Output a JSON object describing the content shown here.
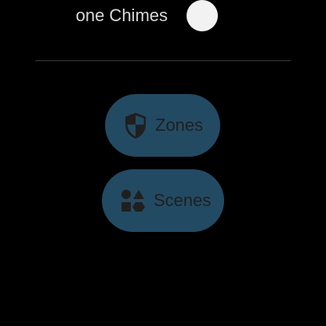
{
  "header": {
    "title_partial": "one Chimes"
  },
  "buttons": [
    {
      "label": "Zones",
      "icon": "shield-icon"
    },
    {
      "label": "Scenes",
      "icon": "shapes-icon"
    }
  ],
  "colors": {
    "pill_bg": "#234a63",
    "text": "#1f1f1f",
    "toggle": "#f2f2f2",
    "background": "#000000"
  }
}
